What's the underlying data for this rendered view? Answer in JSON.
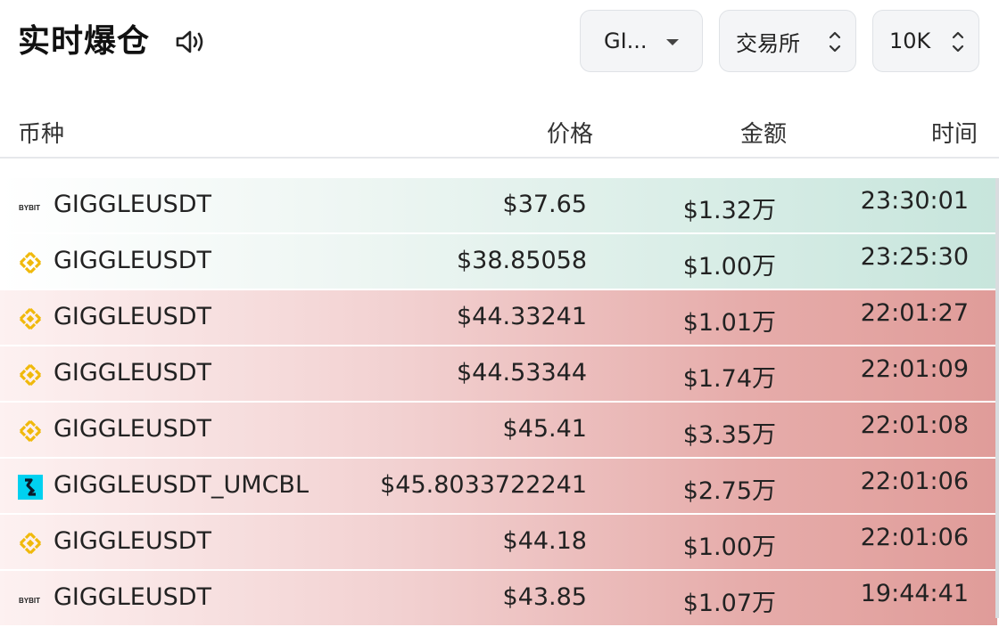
{
  "header": {
    "title": "实时爆仓",
    "coin_filter": "GI...",
    "exchange_filter": "交易所",
    "amount_filter": "10K"
  },
  "table": {
    "columns": [
      "币种",
      "价格",
      "金额",
      "时间"
    ],
    "rows": [
      {
        "exchange_icon": "bybit-icon",
        "symbol": "GIGGLEUSDT",
        "price": "$37.65",
        "amount": "$1.32万",
        "time": "23:30:01",
        "side": "long"
      },
      {
        "exchange_icon": "binance-icon",
        "symbol": "GIGGLEUSDT",
        "price": "$38.85058",
        "amount": "$1.00万",
        "time": "23:25:30",
        "side": "long"
      },
      {
        "exchange_icon": "binance-icon",
        "symbol": "GIGGLEUSDT",
        "price": "$44.33241",
        "amount": "$1.01万",
        "time": "22:01:27",
        "side": "short"
      },
      {
        "exchange_icon": "binance-icon",
        "symbol": "GIGGLEUSDT",
        "price": "$44.53344",
        "amount": "$1.74万",
        "time": "22:01:09",
        "side": "short"
      },
      {
        "exchange_icon": "binance-icon",
        "symbol": "GIGGLEUSDT",
        "price": "$45.41",
        "amount": "$3.35万",
        "time": "22:01:08",
        "side": "short"
      },
      {
        "exchange_icon": "bitget-icon",
        "symbol": "GIGGLEUSDT_UMCBL",
        "price": "$45.8033722241",
        "amount": "$2.75万",
        "time": "22:01:06",
        "side": "short"
      },
      {
        "exchange_icon": "binance-icon",
        "symbol": "GIGGLEUSDT",
        "price": "$44.18",
        "amount": "$1.00万",
        "time": "22:01:06",
        "side": "short"
      },
      {
        "exchange_icon": "bybit-icon",
        "symbol": "GIGGLEUSDT",
        "price": "$43.85",
        "amount": "$1.07万",
        "time": "19:44:41",
        "side": "short"
      }
    ]
  },
  "icons": {
    "bybit_label": "BYBIT"
  },
  "colors": {
    "long_row": "#c7e5dc",
    "short_row": "#e09c99",
    "binance_yellow": "#f0b90b",
    "bitget_cyan": "#00d1f0"
  }
}
